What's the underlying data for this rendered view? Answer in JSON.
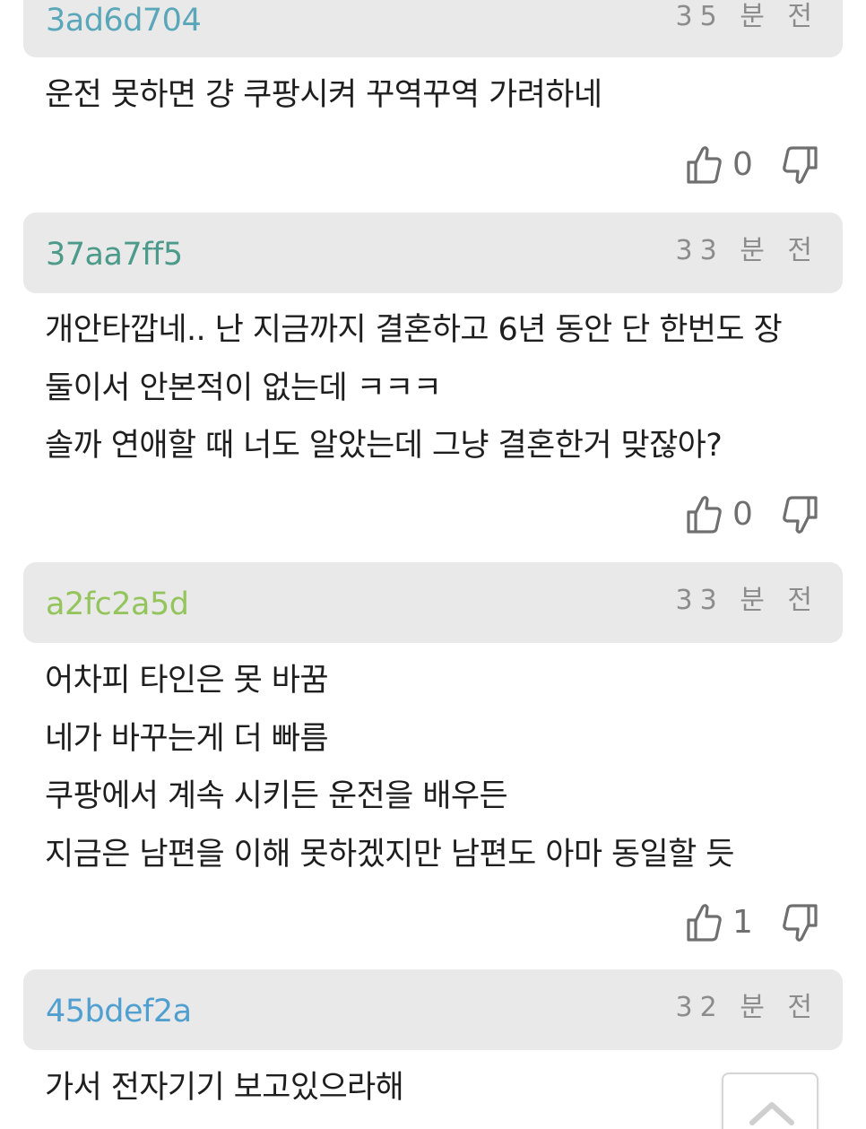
{
  "colors": {
    "header_bg": "#e9e9e9",
    "time_text": "#8c8c8c",
    "body_text": "#1e1e1e",
    "vote_icon": "#6f6f6f"
  },
  "comments": [
    {
      "author": "3ad6d704",
      "author_color": "#5aa7b9",
      "time": "35 분 전",
      "lines": [
        "운전 못하면 걍 쿠팡시켜 꾸역꾸역 가려하네"
      ],
      "likes": "0",
      "like_icon": "thumbs-up-icon",
      "dislike_icon": "thumbs-down-icon"
    },
    {
      "author": "37aa7ff5",
      "author_color": "#4c9a8a",
      "time": "33 분 전",
      "lines": [
        "개안타깝네.. 난 지금까지 결혼하고 6년 동안 단 한번도 장",
        "둘이서 안본적이 없는데 ㅋㅋㅋ",
        "솔까 연애할 때 너도 알았는데 그냥 결혼한거 맞잖아?"
      ],
      "likes": "0",
      "like_icon": "thumbs-up-icon",
      "dislike_icon": "thumbs-down-icon"
    },
    {
      "author": "a2fc2a5d",
      "author_color": "#94c45c",
      "time": "33 분 전",
      "lines": [
        "어차피 타인은 못 바꿈",
        "네가 바꾸는게 더 빠름",
        "쿠팡에서 계속 시키든 운전을 배우든",
        "지금은 남편을 이해 못하겠지만 남편도 아마 동일할 듯"
      ],
      "likes": "1",
      "like_icon": "thumbs-up-icon",
      "dislike_icon": "thumbs-down-icon"
    },
    {
      "author": "45bdef2a",
      "author_color": "#4f9fd0",
      "time": "32 분 전",
      "lines": [
        "가서 전자기기 보고있으라해"
      ]
    }
  ],
  "scroll_top": {
    "icon": "chevron-up-icon"
  }
}
